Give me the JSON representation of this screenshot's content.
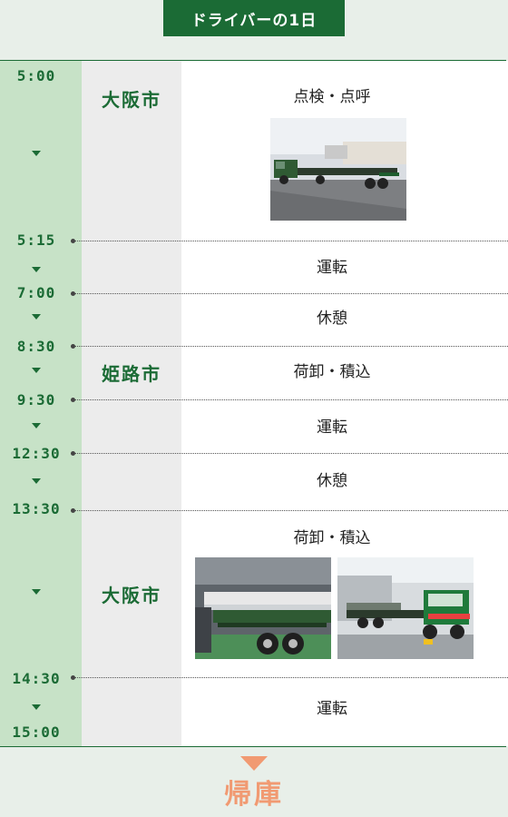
{
  "header": {
    "title": "ドライバーの1日"
  },
  "times": [
    "5:00",
    "5:15",
    "7:00",
    "8:30",
    "9:30",
    "12:30",
    "13:30",
    "14:30",
    "15:00"
  ],
  "locations": [
    "大阪市",
    "姫路市",
    "大阪市"
  ],
  "activities": [
    "点検・点呼",
    "運転",
    "休憩",
    "荷卸・積込",
    "運転",
    "休憩",
    "荷卸・積込",
    "運転"
  ],
  "footer": {
    "label": "帰庫"
  }
}
